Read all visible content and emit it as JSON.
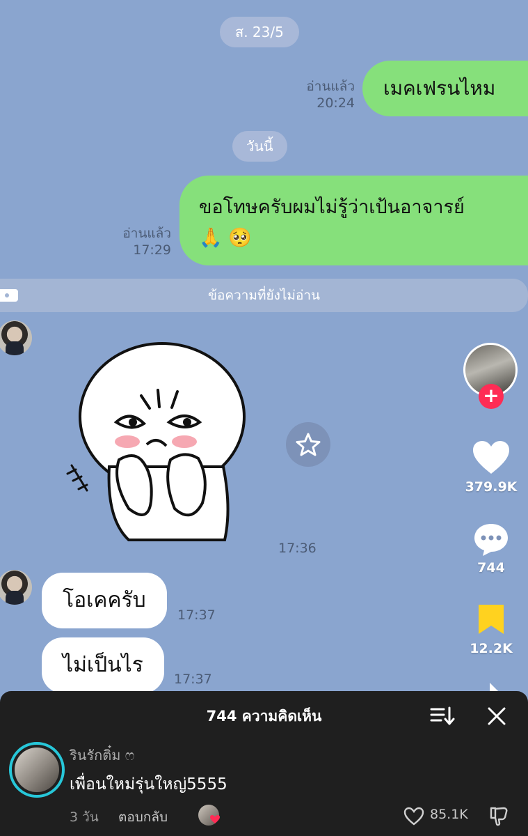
{
  "chat": {
    "date_sat": "ส. 23/5",
    "date_today": "วันนี้",
    "messages_out": [
      {
        "text": "เมคเฟรนไหม",
        "read_label": "อ่านแล้ว",
        "time": "20:24"
      },
      {
        "text_line1": "ขอโทษครับผมไม่รู้ว่าเป้นอาจารย์",
        "text_line2": "🙏 🥺",
        "read_label": "อ่านแล้ว",
        "time": "17:29"
      }
    ],
    "unread_divider": "ข้อความที่ยังไม่อ่าน",
    "sticker_time": "17:36",
    "messages_in": [
      {
        "text": "โอเคครับ",
        "time": "17:37"
      },
      {
        "text": "ไม่เป็นไร",
        "time": "17:37"
      }
    ]
  },
  "rail": {
    "likes": "379.9K",
    "comments": "744",
    "saves": "12.2K",
    "icons": {
      "follow": "plus-icon",
      "like": "heart-icon",
      "comment": "comment-bubble-icon",
      "save": "bookmark-icon",
      "share": "share-arrow-icon"
    }
  },
  "sheet": {
    "title": "744 ความคิดเห็น",
    "icons": {
      "sort": "sort-icon",
      "close": "close-icon"
    },
    "comment": {
      "username": "รินรักติ๋ม ෆ",
      "text": "เพื่อนใหม่รุ่นใหญ่5555",
      "age": "3 วัน",
      "reply_label": "ตอบกลับ",
      "like_count": "85.1K"
    }
  },
  "colors": {
    "chat_bg": "#8aa5cf",
    "bubble_out": "#86e07b",
    "bubble_in": "#ffffff",
    "sheet_bg": "#1f1f1f",
    "accent_red": "#fe2c55",
    "save_yellow": "#ffd21f"
  }
}
